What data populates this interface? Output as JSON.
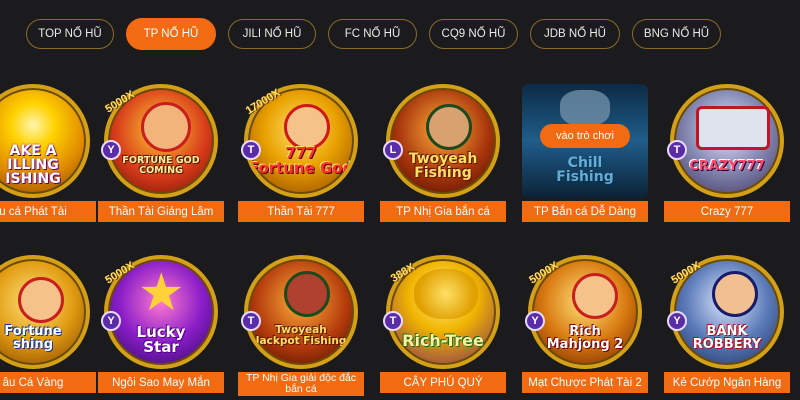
{
  "tabs": [
    {
      "label": "TOP NỔ HŨ",
      "active": false
    },
    {
      "label": "TP NỔ HŨ",
      "active": true
    },
    {
      "label": "JILI NỔ HŨ",
      "active": false
    },
    {
      "label": "FC NỔ HŨ",
      "active": false
    },
    {
      "label": "CQ9 NỔ HŨ",
      "active": false
    },
    {
      "label": "JDB NỔ HŨ",
      "active": false
    },
    {
      "label": "BNG NỔ HŨ",
      "active": false
    }
  ],
  "games": [
    {
      "name": "u cá Phát Tài",
      "logo": "AKE A\nILLING\nISHING"
    },
    {
      "name": "Thần Tài Giáng Lâm",
      "logo": "FORTUNE GOD\nCOMING",
      "multiplier": "5000X",
      "badge": "Y"
    },
    {
      "name": "Thần Tài 777",
      "logo": "777\nFortune God",
      "multiplier": "17000X",
      "badge": "T"
    },
    {
      "name": "TP Nhị Gia bắn cá",
      "logo": "Twoyeah\nFishing",
      "badge": "L"
    },
    {
      "name": "TP Bắn cá Dễ Dàng",
      "logo": "Chill\nFishing",
      "play_label": "vào trò chơi"
    },
    {
      "name": "Crazy 777",
      "logo": "CRAZY777",
      "badge": "T"
    },
    {
      "name": "âu Cá Vàng",
      "logo": "Fortune\nshing"
    },
    {
      "name": "Ngôi Sao May Mắn",
      "logo": "Lucky\nStar",
      "multiplier": "5000X",
      "badge": "Y"
    },
    {
      "name": "TP Nhị Gia giải độc đắc bắn cá",
      "logo": "Twoyeah\nJackpot Fishing",
      "badge": "T"
    },
    {
      "name": "CÂY PHÚ QUÝ",
      "logo": "Rich-Tree",
      "multiplier": "388X",
      "badge": "T"
    },
    {
      "name": "Mạt Chược Phát Tài 2",
      "logo": "Rich\nMahjong 2",
      "multiplier": "5000X",
      "badge": "Y"
    },
    {
      "name": "Kẻ Cướp Ngân Hàng",
      "logo": "BANK\nROBBERY",
      "multiplier": "5000X",
      "badge": "Y"
    }
  ],
  "colors": {
    "accent": "#f26b12",
    "background": "#1b1b1d",
    "tab_border": "#8a6a2a",
    "gold_ring": "#d4a017"
  }
}
